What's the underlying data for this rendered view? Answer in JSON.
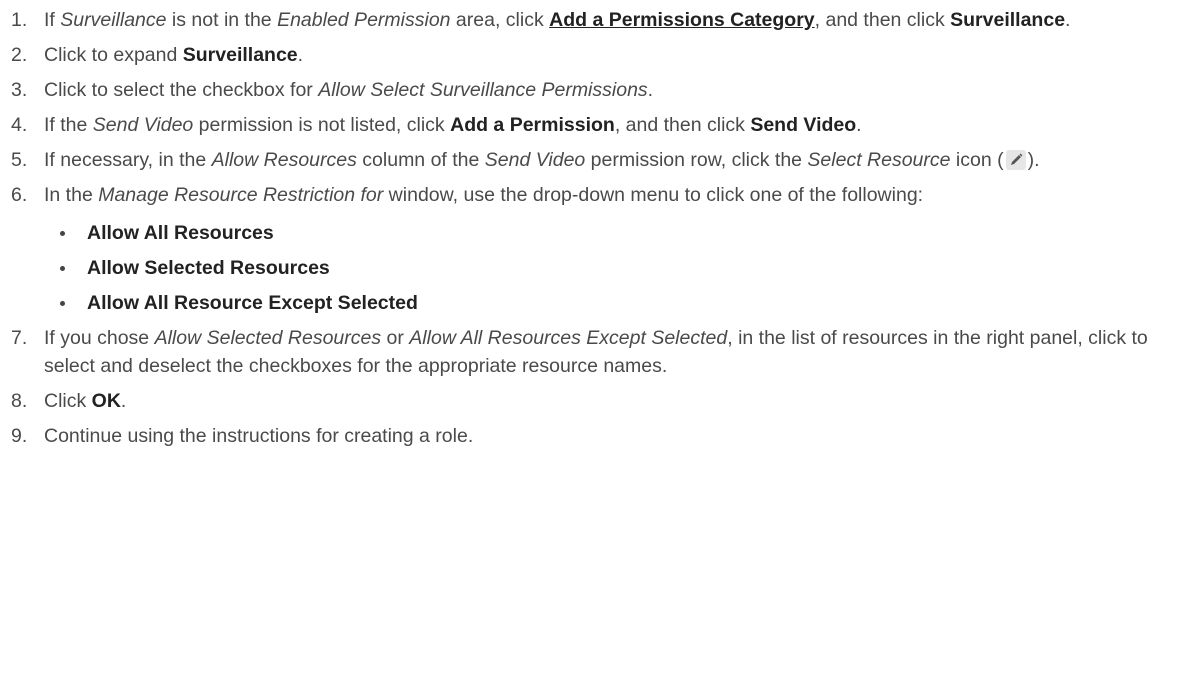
{
  "steps": [
    {
      "num": "1.",
      "parts": [
        {
          "t": "If ",
          "s": ""
        },
        {
          "t": "Surveillance",
          "s": "i"
        },
        {
          "t": " is not in the ",
          "s": ""
        },
        {
          "t": "Enabled Permission",
          "s": "i"
        },
        {
          "t": " area, click ",
          "s": ""
        },
        {
          "t": "Add a Permissions Category",
          "s": "b u"
        },
        {
          "t": ", and then click ",
          "s": ""
        },
        {
          "t": "Surveillance",
          "s": "b"
        },
        {
          "t": ".",
          "s": ""
        }
      ]
    },
    {
      "num": "2.",
      "parts": [
        {
          "t": "Click to expand ",
          "s": ""
        },
        {
          "t": "Surveillance",
          "s": "b"
        },
        {
          "t": ".",
          "s": ""
        }
      ]
    },
    {
      "num": "3.",
      "parts": [
        {
          "t": "Click to select the checkbox for ",
          "s": ""
        },
        {
          "t": "Allow Select Surveillance Permissions",
          "s": "i"
        },
        {
          "t": ".",
          "s": ""
        }
      ]
    },
    {
      "num": "4.",
      "parts": [
        {
          "t": "If the ",
          "s": ""
        },
        {
          "t": "Send Video",
          "s": "i"
        },
        {
          "t": " permission is not listed, click ",
          "s": ""
        },
        {
          "t": "Add a Permission",
          "s": "b"
        },
        {
          "t": ", and then click ",
          "s": ""
        },
        {
          "t": "Send Video",
          "s": "b"
        },
        {
          "t": ".",
          "s": ""
        }
      ]
    },
    {
      "num": "5.",
      "parts": [
        {
          "t": "If necessary, in the ",
          "s": ""
        },
        {
          "t": "Allow Resources",
          "s": "i"
        },
        {
          "t": " column of the ",
          "s": ""
        },
        {
          "t": "Send Video",
          "s": "i"
        },
        {
          "t": " permission row, click the ",
          "s": ""
        },
        {
          "t": "Select Resource",
          "s": "i"
        },
        {
          "t": " icon (",
          "s": ""
        },
        {
          "icon": "pencil-icon"
        },
        {
          "t": ").",
          "s": ""
        }
      ]
    },
    {
      "num": "6.",
      "parts": [
        {
          "t": "In the ",
          "s": ""
        },
        {
          "t": "Manage Resource Restriction for",
          "s": "i"
        },
        {
          "t": " window, use the drop-down menu to click one of the following:",
          "s": ""
        }
      ],
      "bullets": [
        "Allow All Resources",
        "Allow Selected Resources",
        "Allow All Resource Except Selected"
      ]
    },
    {
      "num": "7.",
      "parts": [
        {
          "t": "If you chose ",
          "s": ""
        },
        {
          "t": "Allow Selected Resources",
          "s": "i"
        },
        {
          "t": " or ",
          "s": ""
        },
        {
          "t": "Allow All Resources Except Selected",
          "s": "i"
        },
        {
          "t": ", in the list of resources in the right panel, click to select and deselect the checkboxes for the appropriate resource names.",
          "s": ""
        }
      ]
    },
    {
      "num": "8.",
      "parts": [
        {
          "t": "Click ",
          "s": ""
        },
        {
          "t": "OK",
          "s": "b"
        },
        {
          "t": ".",
          "s": ""
        }
      ]
    },
    {
      "num": "9.",
      "parts": [
        {
          "t": "Continue using the instructions for creating a role.",
          "s": ""
        }
      ]
    }
  ],
  "colors": {
    "text": "#4a4a4a",
    "emphasis": "#222222",
    "pencil_bg": "#e6e6e6",
    "pencil": "#555555"
  }
}
